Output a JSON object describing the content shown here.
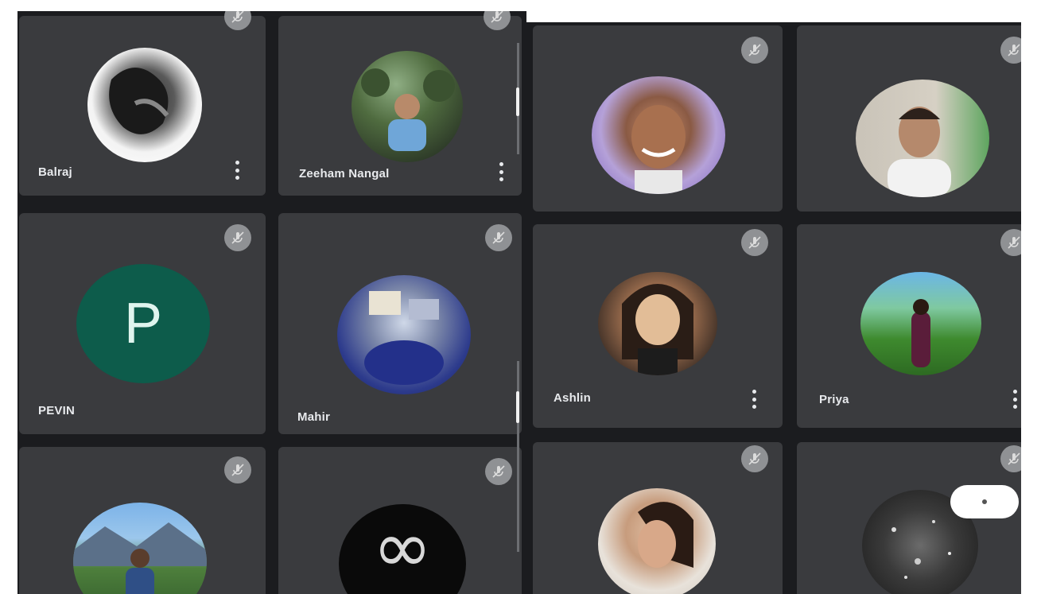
{
  "participants": [
    {
      "id": "balraj",
      "name": "Balraj",
      "avatar_kind": "photo",
      "avatar_desc": "bw-figure",
      "show_menu": true
    },
    {
      "id": "zeeham",
      "name": "Zeeham Nangal",
      "avatar_kind": "photo",
      "avatar_desc": "person-outdoors",
      "show_menu": true
    },
    {
      "id": "p3",
      "name": "",
      "avatar_kind": "photo",
      "avatar_desc": "smiling-man",
      "show_menu": false
    },
    {
      "id": "p4",
      "name": "",
      "avatar_kind": "photo",
      "avatar_desc": "young-man",
      "show_menu": false
    },
    {
      "id": "pevin",
      "name": "PEVIN",
      "avatar_kind": "letter",
      "avatar_letter": "P",
      "avatar_color": "#0d5c4b",
      "show_menu": false
    },
    {
      "id": "mahir",
      "name": "Mahir",
      "avatar_kind": "photo",
      "avatar_desc": "blue-scene",
      "show_menu": false
    },
    {
      "id": "ashlin",
      "name": "Ashlin",
      "avatar_kind": "photo",
      "avatar_desc": "cartoon-girl",
      "show_menu": true
    },
    {
      "id": "priya",
      "name": "Priya",
      "avatar_kind": "photo",
      "avatar_desc": "green-landscape",
      "show_menu": true
    },
    {
      "id": "p9",
      "name": "",
      "avatar_kind": "photo",
      "avatar_desc": "mountain-man",
      "show_menu": false
    },
    {
      "id": "p10",
      "name": "",
      "avatar_kind": "symbol",
      "avatar_symbol": "∞",
      "show_menu": false
    },
    {
      "id": "p11",
      "name": "",
      "avatar_kind": "photo",
      "avatar_desc": "woman-portrait",
      "show_menu": false
    },
    {
      "id": "p12",
      "name": "",
      "avatar_kind": "photo",
      "avatar_desc": "dark-sparkle",
      "show_menu": false
    }
  ],
  "icons": {
    "mute": "mic-off-icon",
    "menu": "more-vert-icon"
  },
  "colors": {
    "background": "#1b1c1f",
    "tile": "#3a3b3e",
    "mute_badge": "#8f9194",
    "text": "#e8eaed"
  }
}
